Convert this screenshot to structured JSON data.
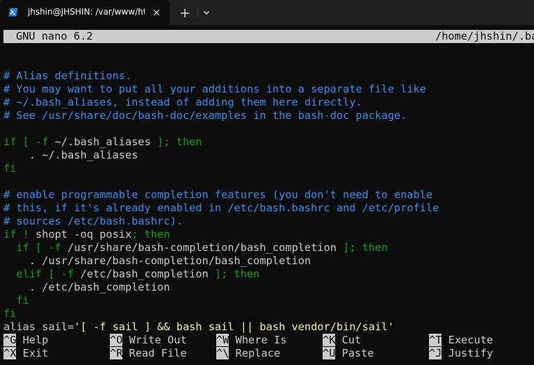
{
  "window": {
    "tab_title": "jhshin@JHSHIN: /var/www/htr",
    "icons": {
      "tab": "powershell-icon",
      "close": "close-icon",
      "new_tab": "plus-icon",
      "dropdown": "chevron-down-icon"
    }
  },
  "nano": {
    "version": "GNU nano 6.2",
    "filename": "/home/jhshin/.ba"
  },
  "editor": {
    "lines": [
      [],
      [
        {
          "c": "cmt",
          "t": "# Alias definitions."
        }
      ],
      [
        {
          "c": "cmt",
          "t": "# You may want to put all your additions into a separate file like"
        }
      ],
      [
        {
          "c": "cmt",
          "t": "# ~/.bash_aliases, instead of adding them here directly."
        }
      ],
      [
        {
          "c": "cmt",
          "t": "# See /usr/share/doc/bash-doc/examples in the bash-doc package."
        }
      ],
      [],
      [
        {
          "c": "kw",
          "t": "if [ -f "
        },
        {
          "c": "plain",
          "t": "~/.bash_aliases"
        },
        {
          "c": "kw",
          "t": " ]; then"
        }
      ],
      [
        {
          "c": "plain",
          "t": "    . ~/.bash_aliases"
        }
      ],
      [
        {
          "c": "kw",
          "t": "fi"
        }
      ],
      [],
      [
        {
          "c": "cmt",
          "t": "# enable programmable completion features (you don't need to enable"
        }
      ],
      [
        {
          "c": "cmt",
          "t": "# this, if it's already enabled in /etc/bash.bashrc and /etc/profile"
        }
      ],
      [
        {
          "c": "cmt",
          "t": "# sources /etc/bash.bashrc)."
        }
      ],
      [
        {
          "c": "kw",
          "t": "if ! "
        },
        {
          "c": "plain",
          "t": "shopt -oq posix"
        },
        {
          "c": "kw",
          "t": "; then"
        }
      ],
      [
        {
          "c": "kw",
          "t": "  if [ -f "
        },
        {
          "c": "plain",
          "t": "/usr/share/bash-completion/bash_completion"
        },
        {
          "c": "kw",
          "t": " ]; then"
        }
      ],
      [
        {
          "c": "plain",
          "t": "    . /usr/share/bash-completion/bash_completion"
        }
      ],
      [
        {
          "c": "kw",
          "t": "  elif [ -f "
        },
        {
          "c": "plain",
          "t": "/etc/bash_completion"
        },
        {
          "c": "kw",
          "t": " ]; then"
        }
      ],
      [
        {
          "c": "plain",
          "t": "    . /etc/bash_completion"
        }
      ],
      [
        {
          "c": "kw",
          "t": "  fi"
        }
      ],
      [
        {
          "c": "kw",
          "t": "fi"
        }
      ],
      [
        {
          "c": "plain",
          "t": "alias sail="
        },
        {
          "c": "str",
          "t": "'[ -f sail ] && bash sail || bash vendor/bin/sail'"
        }
      ]
    ]
  },
  "shortcuts": [
    {
      "key": "^G",
      "label": "Help"
    },
    {
      "key": "^O",
      "label": "Write Out"
    },
    {
      "key": "^W",
      "label": "Where Is"
    },
    {
      "key": "^K",
      "label": "Cut"
    },
    {
      "key": "^T",
      "label": "Execute"
    },
    {
      "key": "^X",
      "label": "Exit"
    },
    {
      "key": "^R",
      "label": "Read File"
    },
    {
      "key": "^\\",
      "label": "Replace"
    },
    {
      "key": "^U",
      "label": "Paste"
    },
    {
      "key": "^J",
      "label": "Justify"
    }
  ],
  "colors": {
    "background": "#0c0c0c",
    "text": "#cccccc",
    "comment": "#3b8eea",
    "keyword": "#13a10e",
    "string": "#f9f1a5",
    "tabstrip": "#202020"
  }
}
